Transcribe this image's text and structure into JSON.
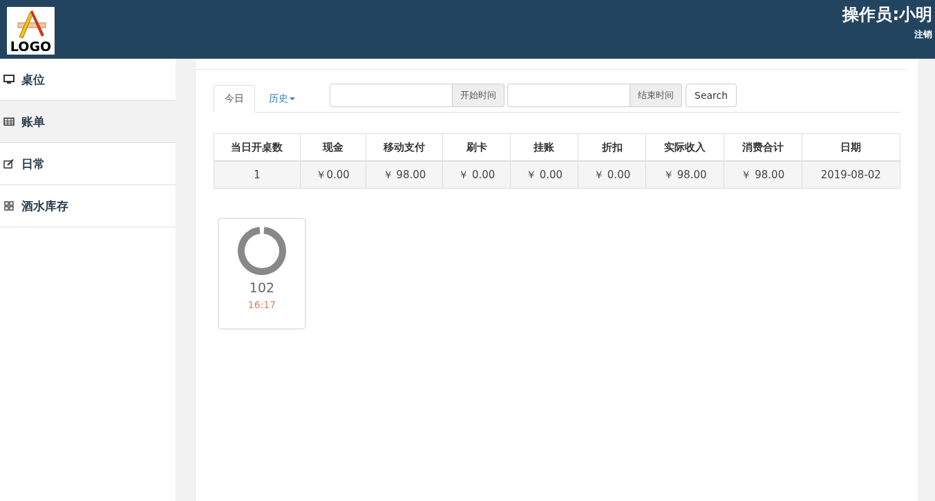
{
  "header": {
    "logo_text": "LOGO",
    "operator": "操作员:小明",
    "logout": "注销"
  },
  "sidebar": {
    "items": [
      {
        "kind": "monitor",
        "label": "桌位",
        "selected": false
      },
      {
        "kind": "table",
        "label": "账单",
        "selected": true
      },
      {
        "kind": "edit",
        "label": "日常",
        "selected": false
      },
      {
        "kind": "grid",
        "label": "酒水库存",
        "selected": false
      }
    ]
  },
  "tabs": [
    {
      "label": "今日",
      "selected": true,
      "dropdown": false
    },
    {
      "label": "历史",
      "selected": false,
      "dropdown": true
    }
  ],
  "search": {
    "start_addon": "开始时间",
    "end_addon": "结束时间",
    "button": "Search"
  },
  "table": {
    "columns": [
      "当日开桌数",
      "现金",
      "移动支付",
      "刷卡",
      "挂账",
      "折扣",
      "实际收入",
      "消费合计",
      "日期"
    ],
    "rows": [
      [
        "1",
        "￥0.00",
        "￥ 98.00",
        "￥ 0.00",
        "￥ 0.00",
        "￥ 0.00",
        "￥ 98.00",
        "￥ 98.00",
        "2019-08-02"
      ]
    ]
  },
  "tables": [
    {
      "number": "102",
      "time": "16:17"
    }
  ]
}
